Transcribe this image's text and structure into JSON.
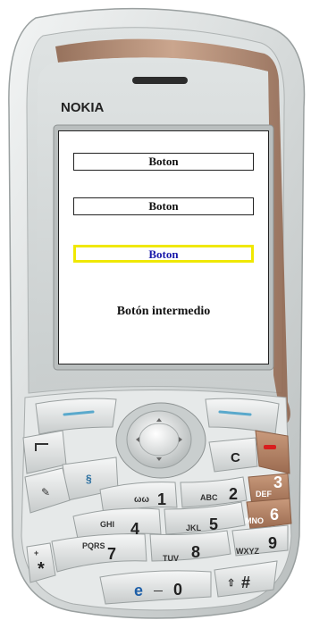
{
  "phone": {
    "brand": "NOKIA",
    "keys": [
      {
        "id": "1",
        "digit": "1",
        "letters": "ωω"
      },
      {
        "id": "2",
        "digit": "2",
        "letters": "ABC"
      },
      {
        "id": "3",
        "digit": "3",
        "letters": "DEF"
      },
      {
        "id": "4",
        "digit": "4",
        "letters": "GHI"
      },
      {
        "id": "5",
        "digit": "5",
        "letters": "JKL"
      },
      {
        "id": "6",
        "digit": "6",
        "letters": "MNO"
      },
      {
        "id": "7",
        "digit": "7",
        "letters": "PQRS"
      },
      {
        "id": "8",
        "digit": "8",
        "letters": "TUV"
      },
      {
        "id": "9",
        "digit": "9",
        "letters": "WXYZ"
      },
      {
        "id": "star",
        "digit": "*",
        "letters": "+"
      },
      {
        "id": "0",
        "digit": "0",
        "letters": "—"
      },
      {
        "id": "hash",
        "digit": "#",
        "letters": "⇧"
      }
    ],
    "clear_key": "C"
  },
  "screen": {
    "buttons": [
      {
        "label": "Boton",
        "selected": false
      },
      {
        "label": "Boton",
        "selected": false
      },
      {
        "label": "Boton",
        "selected": true
      }
    ],
    "middle_text": "Botón intermedio"
  },
  "colors": {
    "body_silver": "#d9dcdc",
    "bronze_accent": "#b0836a",
    "selection_border": "#f0e800",
    "selected_text": "#1a1aaa"
  }
}
